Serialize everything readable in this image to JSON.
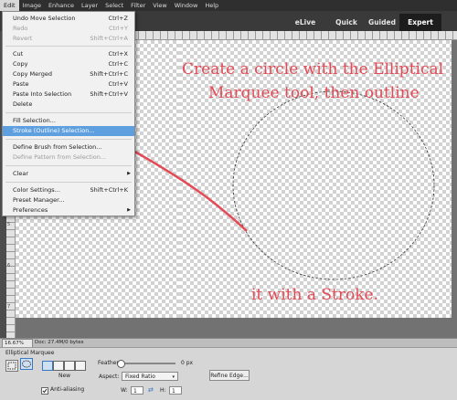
{
  "menubar": {
    "items": [
      "Edit",
      "Image",
      "Enhance",
      "Layer",
      "Select",
      "Filter",
      "View",
      "Window",
      "Help"
    ]
  },
  "modes": {
    "elive": "eLive",
    "quick": "Quick",
    "guided": "Guided",
    "expert": "Expert"
  },
  "edit_menu": {
    "items": [
      {
        "label": "Undo Move Selection",
        "shortcut": "Ctrl+Z",
        "enabled": true
      },
      {
        "label": "Redo",
        "shortcut": "Ctrl+Y",
        "enabled": false
      },
      {
        "label": "Revert",
        "shortcut": "Shift+Ctrl+A",
        "enabled": false
      },
      {
        "label": "Cut",
        "shortcut": "Ctrl+X",
        "enabled": true
      },
      {
        "label": "Copy",
        "shortcut": "Ctrl+C",
        "enabled": true
      },
      {
        "label": "Copy Merged",
        "shortcut": "Shift+Ctrl+C",
        "enabled": true
      },
      {
        "label": "Paste",
        "shortcut": "Ctrl+V",
        "enabled": true
      },
      {
        "label": "Paste Into Selection",
        "shortcut": "Shift+Ctrl+V",
        "enabled": true
      },
      {
        "label": "Delete",
        "shortcut": "",
        "enabled": true
      },
      {
        "label": "Fill Selection...",
        "shortcut": "",
        "enabled": true
      },
      {
        "label": "Stroke (Outline) Selection...",
        "shortcut": "",
        "enabled": true,
        "highlighted": true
      },
      {
        "label": "Define Brush from Selection...",
        "shortcut": "",
        "enabled": true
      },
      {
        "label": "Define Pattern from Selection...",
        "shortcut": "",
        "enabled": false
      },
      {
        "label": "Clear",
        "shortcut": "",
        "enabled": true,
        "submenu": true
      },
      {
        "label": "Color Settings...",
        "shortcut": "Shift+Ctrl+K",
        "enabled": true
      },
      {
        "label": "Preset Manager...",
        "shortcut": "",
        "enabled": true
      },
      {
        "label": "Preferences",
        "shortcut": "",
        "enabled": true,
        "submenu": true
      }
    ]
  },
  "ruler": {
    "left_numbers": [
      "1",
      "2",
      "3",
      "4",
      "5",
      "6",
      "7"
    ]
  },
  "annotation": {
    "line1": "Create a circle with the Elliptical",
    "line2": "Marquee tool, then outline",
    "line3": "it with a Stroke."
  },
  "status": {
    "zoom": "16.67%",
    "doc": "Doc: 27.4M/0 bytes"
  },
  "options": {
    "tool_name": "Elliptical Marquee",
    "mode_label": "New",
    "feather_label": "Feather:",
    "feather_value": "0 px",
    "aspect_label": "Aspect:",
    "aspect_value": "Fixed Ratio",
    "w_label": "W:",
    "w_value": "1",
    "h_label": "H:",
    "h_value": "1",
    "refine_edge": "Refine Edge...",
    "anti_aliasing": "Anti-aliasing"
  },
  "colors": {
    "annotation": "#e34a55",
    "highlight": "#5e9fe0",
    "menubar": "#2f2f2f"
  }
}
